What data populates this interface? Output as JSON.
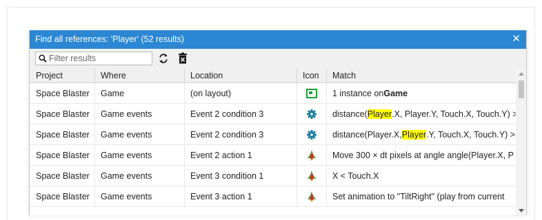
{
  "dialog": {
    "title": "Find all references: 'Player' (52 results)",
    "close_glyph": "✕",
    "accent_color": "#2b87d3"
  },
  "toolbar": {
    "filter_placeholder": "Filter results",
    "search_icon": "search-icon",
    "refresh_icon": "refresh-icon",
    "clear_icon": "clear-results-icon"
  },
  "table": {
    "columns": [
      "Project",
      "Where",
      "Location",
      "Icon",
      "Match"
    ],
    "rows": [
      {
        "project": "Space Blaster",
        "where": "Game",
        "location": "(on layout)",
        "icon": "layout-icon",
        "match_pre": "1 instance on ",
        "match_hl": "",
        "match_post": "",
        "match_bold": "Game"
      },
      {
        "project": "Space Blaster",
        "where": "Game events",
        "location": "Event 2 condition 3",
        "icon": "gear-icon",
        "match_pre": "distance(",
        "match_hl": "Player",
        "match_post": ".X, Player.Y, Touch.X, Touch.Y) >",
        "match_bold": ""
      },
      {
        "project": "Space Blaster",
        "where": "Game events",
        "location": "Event 2 condition 3",
        "icon": "gear-icon",
        "match_pre": "distance(Player.X, ",
        "match_hl": "Player",
        "match_post": ".Y, Touch.X, Touch.Y) >",
        "match_bold": ""
      },
      {
        "project": "Space Blaster",
        "where": "Game events",
        "location": "Event 2 action 1",
        "icon": "sprite-ship-icon",
        "match_pre": "Move 300 × dt pixels at angle angle(Player.X, P",
        "match_hl": "",
        "match_post": "",
        "match_bold": ""
      },
      {
        "project": "Space Blaster",
        "where": "Game events",
        "location": "Event 3 condition 1",
        "icon": "sprite-ship-icon",
        "match_pre": "X < Touch.X",
        "match_hl": "",
        "match_post": "",
        "match_bold": ""
      },
      {
        "project": "Space Blaster",
        "where": "Game events",
        "location": "Event 3 action 1",
        "icon": "sprite-ship-icon",
        "match_pre": "Set animation to \"TiltRight\" (play from current",
        "match_hl": "",
        "match_post": "",
        "match_bold": ""
      }
    ]
  }
}
